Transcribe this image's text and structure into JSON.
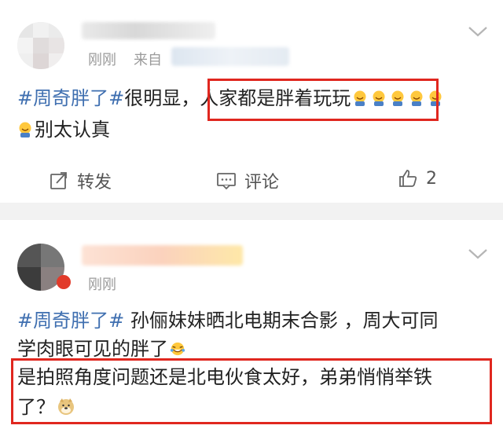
{
  "post1": {
    "time": "刚刚",
    "source_prefix": "来自",
    "line1": {
      "tag": "#周奇胖了#",
      "plain": "很明显，",
      "highlight": "人家都是胖着玩玩"
    },
    "line2": {
      "text": "别太认真"
    },
    "actions": {
      "repost": "转发",
      "comment": "评论",
      "like_count": "2"
    }
  },
  "post2": {
    "time": "刚刚",
    "line1": {
      "tag": "#周奇胖了#",
      "rest": " 孙俪妹妹晒北电期末合影 ，周大可同"
    },
    "line2": {
      "text": "学肉眼可见的胖了"
    },
    "line3": {
      "text": "是拍照角度问题还是北电伙食太好，弟弟悄悄举铁"
    },
    "line4": {
      "text": "了？"
    }
  },
  "colors": {
    "tag": "#3f6fb0",
    "highlight_border": "#e0271f",
    "separator": "#f2f2f2"
  },
  "icons": [
    "chevron-down-icon",
    "crying-laughing-emoji",
    "doge-emoji",
    "repost-icon",
    "comment-icon",
    "like-icon"
  ]
}
